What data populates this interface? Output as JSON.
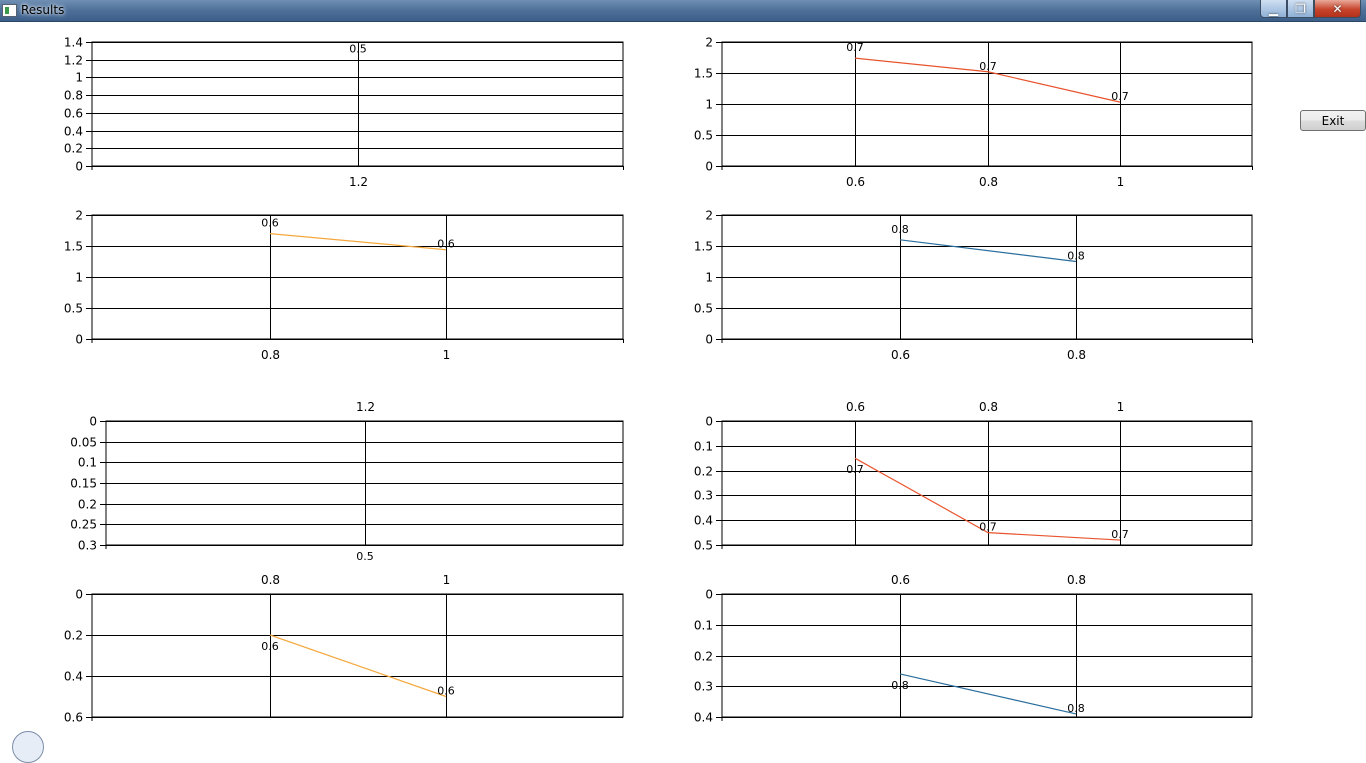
{
  "window": {
    "title": "Results",
    "minimize_glyph": "▁",
    "maximize_glyph": "❐",
    "close_glyph": "✕"
  },
  "exit_button": {
    "label": "Exit"
  },
  "colors": {
    "red": "#e8542d",
    "orange": "#f3a83c",
    "blue": "#2a6e9e",
    "grid": "#000000"
  },
  "chart_data": [
    {
      "type": "line",
      "x_ticks": [
        "1.2"
      ],
      "y_ticks": [
        "0",
        "0.2",
        "0.4",
        "0.6",
        "0.8",
        "1",
        "1.2",
        "1.4"
      ],
      "ylim": [
        0,
        1.4
      ],
      "y_inverted": false,
      "series": [
        {
          "color": "red",
          "points": [
            {
              "x": 1.2,
              "y": 1.2,
              "label": "0.5"
            }
          ]
        }
      ]
    },
    {
      "type": "line",
      "x_ticks": [
        "0.6",
        "0.8",
        "1"
      ],
      "y_ticks": [
        "0",
        "0.5",
        "1",
        "1.5",
        "2"
      ],
      "ylim": [
        0,
        2
      ],
      "y_inverted": false,
      "series": [
        {
          "color": "red",
          "points": [
            {
              "x": 0.6,
              "y": 1.74,
              "label": "0.7"
            },
            {
              "x": 0.8,
              "y": 1.52,
              "label": "0.7"
            },
            {
              "x": 1,
              "y": 1.03,
              "label": "0.7"
            }
          ]
        }
      ]
    },
    {
      "type": "line",
      "x_ticks": [
        "0.8",
        "1"
      ],
      "y_ticks": [
        "0",
        "0.5",
        "1",
        "1.5",
        "2"
      ],
      "ylim": [
        0,
        2
      ],
      "y_inverted": false,
      "series": [
        {
          "color": "orange",
          "points": [
            {
              "x": 0.8,
              "y": 1.7,
              "label": "0.6"
            },
            {
              "x": 1,
              "y": 1.44,
              "label": "0.6"
            }
          ]
        }
      ]
    },
    {
      "type": "line",
      "x_ticks": [
        "0.6",
        "0.8"
      ],
      "y_ticks": [
        "0",
        "0.5",
        "1",
        "1.5",
        "2"
      ],
      "ylim": [
        0,
        2
      ],
      "y_inverted": false,
      "series": [
        {
          "color": "blue",
          "points": [
            {
              "x": 0.6,
              "y": 1.6,
              "label": "0.8"
            },
            {
              "x": 0.8,
              "y": 1.25,
              "label": "0.8"
            }
          ]
        }
      ]
    },
    {
      "type": "line",
      "x_ticks": [
        "1.2"
      ],
      "y_ticks": [
        "0",
        "0.05",
        "0.1",
        "0.15",
        "0.2",
        "0.25",
        "0.3"
      ],
      "ylim": [
        0,
        0.3
      ],
      "y_inverted": true,
      "series": [
        {
          "color": "red",
          "points": [
            {
              "x": 1.2,
              "y": 0.3,
              "label": "0.5"
            }
          ]
        }
      ]
    },
    {
      "type": "line",
      "x_ticks": [
        "0.6",
        "0.8",
        "1"
      ],
      "y_ticks": [
        "0",
        "0.1",
        "0.2",
        "0.3",
        "0.4",
        "0.5"
      ],
      "ylim": [
        0,
        0.5
      ],
      "y_inverted": true,
      "series": [
        {
          "color": "red",
          "points": [
            {
              "x": 0.6,
              "y": 0.15,
              "label": "0.7"
            },
            {
              "x": 0.8,
              "y": 0.45,
              "label": "0.7"
            },
            {
              "x": 1,
              "y": 0.48,
              "label": "0.7"
            }
          ]
        }
      ]
    },
    {
      "type": "line",
      "x_ticks": [
        "0.8",
        "1"
      ],
      "y_ticks": [
        "0",
        "0.2",
        "0.4",
        "0.6"
      ],
      "ylim": [
        0,
        0.6
      ],
      "y_inverted": true,
      "series": [
        {
          "color": "orange",
          "points": [
            {
              "x": 0.8,
              "y": 0.2,
              "label": "0.6"
            },
            {
              "x": 1,
              "y": 0.5,
              "label": "0.6"
            }
          ]
        }
      ]
    },
    {
      "type": "line",
      "x_ticks": [
        "0.6",
        "0.8"
      ],
      "y_ticks": [
        "0",
        "0.1",
        "0.2",
        "0.3",
        "0.4"
      ],
      "ylim": [
        0,
        0.4
      ],
      "y_inverted": true,
      "series": [
        {
          "color": "blue",
          "points": [
            {
              "x": 0.6,
              "y": 0.26,
              "label": "0.8"
            },
            {
              "x": 0.8,
              "y": 0.39,
              "label": "0.8"
            }
          ]
        }
      ]
    }
  ]
}
